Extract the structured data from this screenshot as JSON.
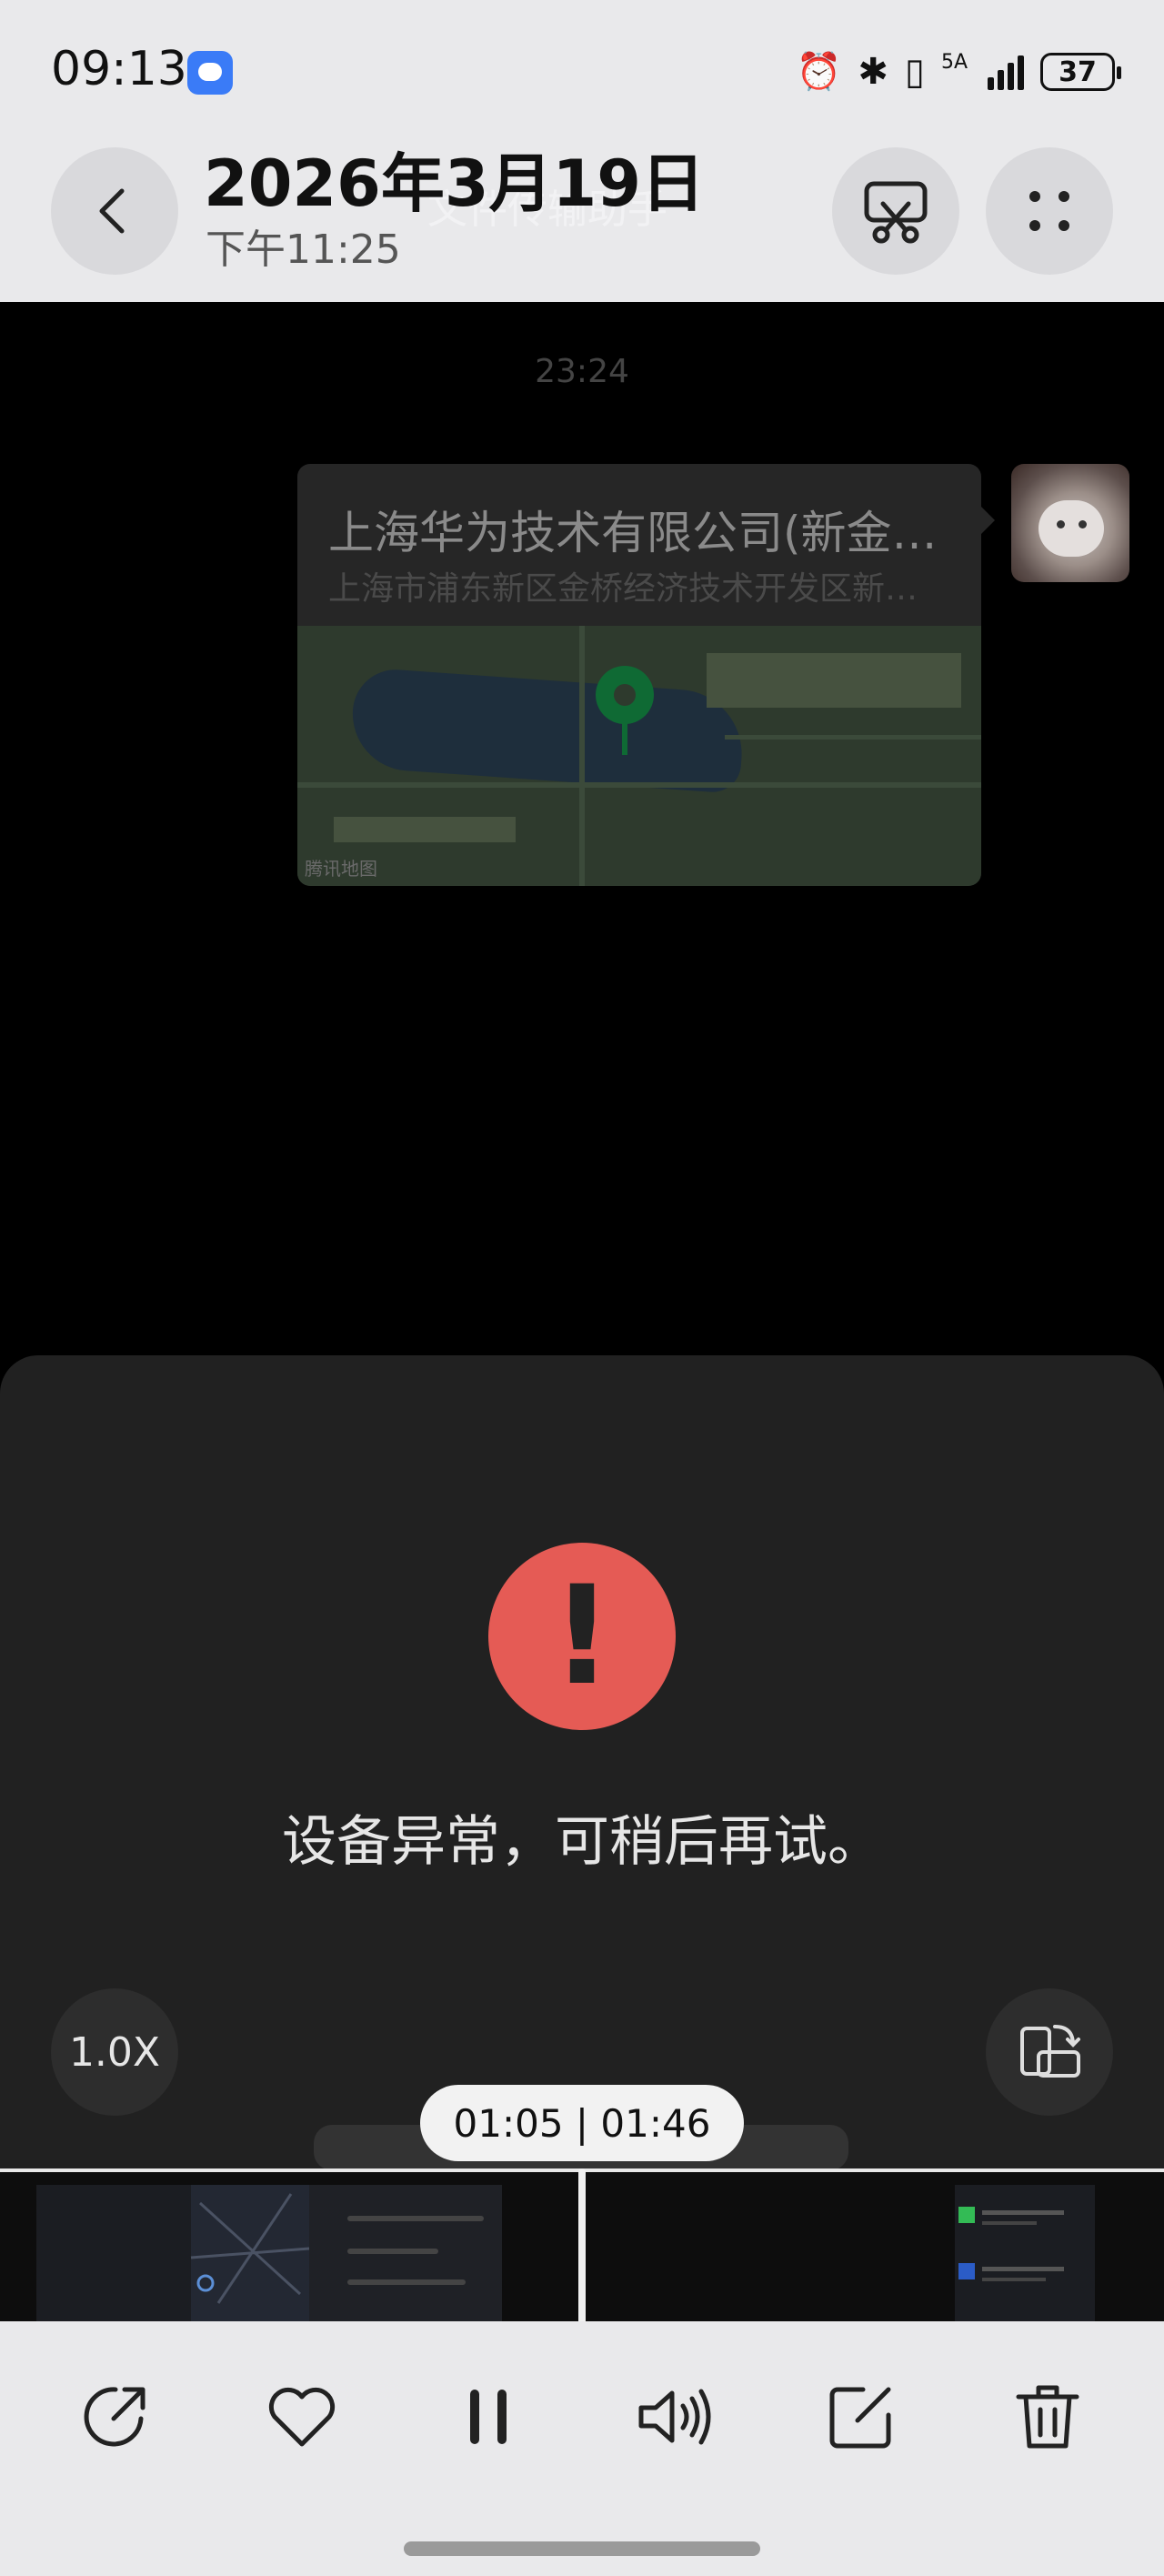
{
  "status_bar": {
    "time": "09:13",
    "network": "5A",
    "battery": "37",
    "icons": [
      "message-notification-icon",
      "alarm-icon",
      "bluetooth-icon",
      "vibrate-icon",
      "signal-icon",
      "battery-icon"
    ]
  },
  "header": {
    "date": "2026年3月19日",
    "time": "下午11:25",
    "ghost_title": "文件传输助手",
    "icons": [
      "back-icon",
      "scissors-icon",
      "more-icon"
    ]
  },
  "chat": {
    "timestamp": "23:24",
    "location_card": {
      "name": "上海华为技术有限公司(新金…",
      "address": "上海市浦东新区金桥经济技术开发区新…",
      "map_credit": "腾讯地图"
    }
  },
  "error": {
    "message": "设备异常，可稍后再试。",
    "icon": "alert-icon"
  },
  "player": {
    "speed": "1.0X",
    "position": "01:05 | 01:46",
    "progress": 0.61
  },
  "toolbar": {
    "buttons": [
      "share",
      "favorite",
      "pause",
      "volume",
      "edit",
      "delete"
    ]
  },
  "colors": {
    "error_red": "#e55b55",
    "panel_bg": "#212121",
    "chrome_bg": "#e9e9eb"
  }
}
